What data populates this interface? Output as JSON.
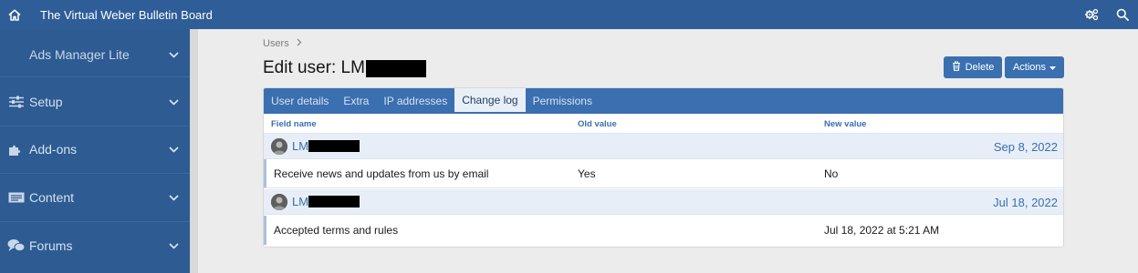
{
  "topbar": {
    "title": "The Virtual Weber Bulletin Board",
    "home_icon": "home-icon",
    "right_icons": [
      "settings-icon",
      "search-icon"
    ]
  },
  "sidebar": {
    "items": [
      {
        "label": "Ads Manager Lite",
        "icon": ""
      },
      {
        "label": "Setup",
        "icon": "sliders-icon"
      },
      {
        "label": "Add-ons",
        "icon": "puzzle-icon"
      },
      {
        "label": "Content",
        "icon": "content-icon"
      },
      {
        "label": "Forums",
        "icon": "forums-icon"
      }
    ]
  },
  "breadcrumb": {
    "items": [
      "Users"
    ]
  },
  "page": {
    "title_prefix": "Edit user: LM"
  },
  "buttons": {
    "delete": "Delete",
    "actions": "Actions"
  },
  "tabs": [
    {
      "label": "User details",
      "active": false
    },
    {
      "label": "Extra",
      "active": false
    },
    {
      "label": "IP addresses",
      "active": false
    },
    {
      "label": "Change log",
      "active": true
    },
    {
      "label": "Permissions",
      "active": false
    }
  ],
  "table": {
    "columns": [
      "Field name",
      "Old value",
      "New value"
    ],
    "groups": [
      {
        "user": "LM",
        "date": "Sep 8, 2022",
        "rows": [
          {
            "field": "Receive news and updates from us by email",
            "old": "Yes",
            "new": "No"
          }
        ]
      },
      {
        "user": "LM",
        "date": "Jul 18, 2022",
        "rows": [
          {
            "field": "Accepted terms and rules",
            "old": "",
            "new": "Jul 18, 2022 at 5:21 AM"
          }
        ]
      }
    ]
  },
  "colors": {
    "topbar": "#2e5d97",
    "sidebar": "#2d5b92",
    "accent": "#3a6fb0",
    "group_row": "#e7eef7",
    "background": "#ececec"
  }
}
